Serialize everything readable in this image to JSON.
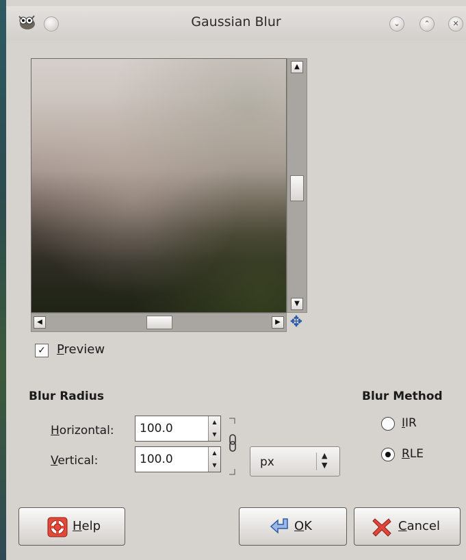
{
  "window": {
    "title": "Gaussian Blur",
    "icons": [
      "gimp-wilber-icon",
      "window-menu-icon",
      "minimize-icon",
      "maximize-icon",
      "close-icon"
    ]
  },
  "preview": {
    "checkbox_checked": true,
    "label_first": "P",
    "label_rest": "review"
  },
  "blur_radius": {
    "heading": "Blur Radius",
    "horizontal_label_first": "H",
    "horizontal_label_rest": "orizontal:",
    "horizontal_value": "100.0",
    "vertical_label_first": "V",
    "vertical_label_rest": "ertical:",
    "vertical_value": "100.0",
    "unit": "px",
    "chain_linked": true
  },
  "blur_method": {
    "heading": "Blur Method",
    "options": [
      {
        "first": "I",
        "rest": "IR",
        "selected": false
      },
      {
        "first": "R",
        "rest": "LE",
        "selected": true
      }
    ]
  },
  "buttons": {
    "help_first": "H",
    "help_rest": "elp",
    "ok_first": "O",
    "ok_rest": "K",
    "cancel_first": "C",
    "cancel_rest": "ancel"
  },
  "colors": {
    "window_bg": "#d6d3cf",
    "nav_icon": "#2a5aa8",
    "cancel_icon": "#d23a2a",
    "ok_icon": "#5b86c9"
  }
}
